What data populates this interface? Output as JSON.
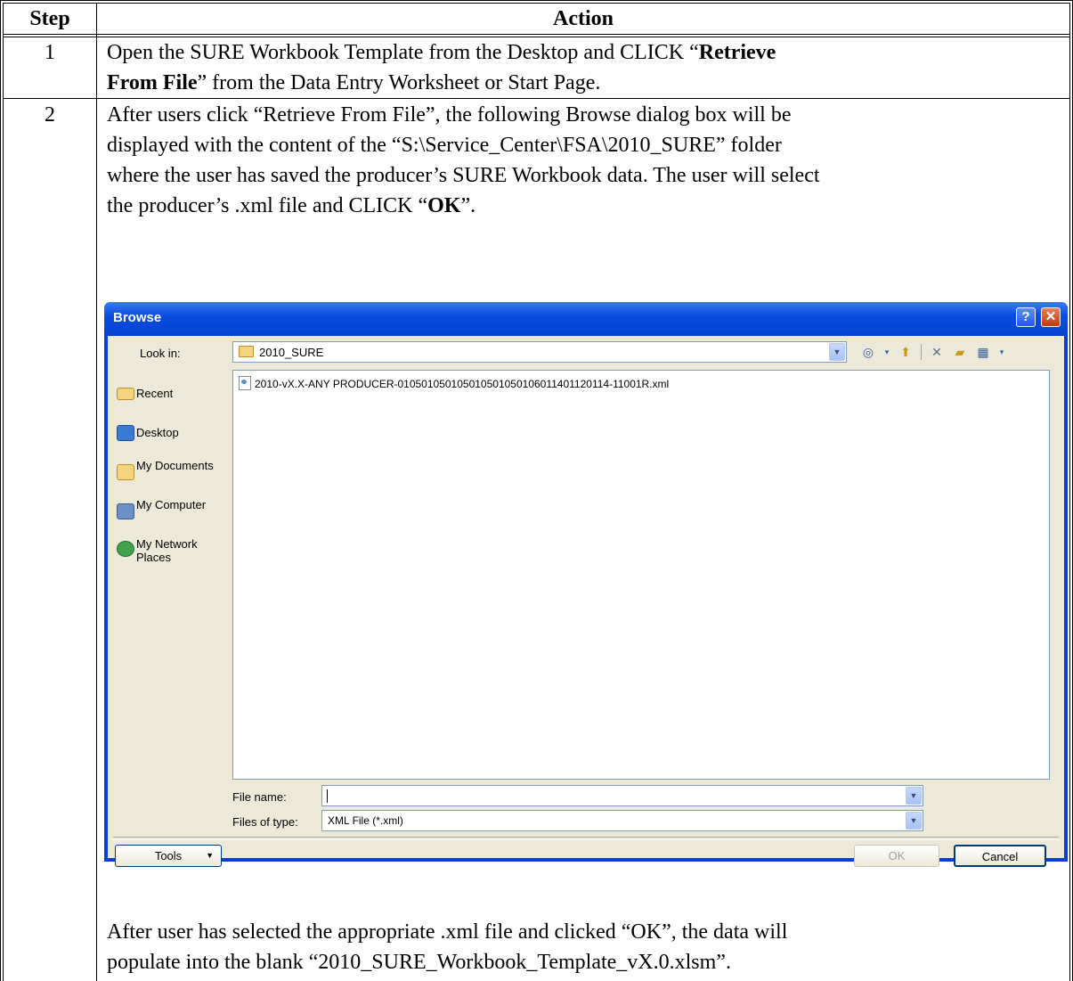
{
  "table": {
    "header_step": "Step",
    "header_action": "Action",
    "rows": [
      {
        "step": "1",
        "line1_pre": "Open the SURE Workbook Template from the Desktop and CLICK “",
        "line1_bold": "Retrieve",
        "line2_bold": "From File",
        "line2_post": "” from the Data Entry Worksheet or Start Page."
      },
      {
        "step": "2",
        "line1": "After users click “Retrieve From File”, the following Browse dialog box will be",
        "line2": "displayed with the content of the “S:\\Service_Center\\FSA\\2010_SURE” folder",
        "line3": "where the user has saved the producer’s SURE Workbook data.  The user will select",
        "line4_pre": "the producer’s .xml file and CLICK “",
        "line4_bold": "OK",
        "line4_post": "”.",
        "after1": "After user has selected the appropriate .xml file and clicked “OK”, the data will",
        "after2": "populate into the blank “2010_SURE_Workbook_Template_vX.0.xlsm”."
      }
    ]
  },
  "dialog": {
    "title": "Browse",
    "help_glyph": "?",
    "close_glyph": "✕",
    "look_in_label": "Look in:",
    "look_in_value": "2010_SURE",
    "places": [
      {
        "label": "Recent",
        "icon": "recent-folder-icon"
      },
      {
        "label": "Desktop",
        "icon": "desktop-icon"
      },
      {
        "label": "My Documents",
        "icon": "my-documents-icon"
      },
      {
        "label": "My Computer",
        "icon": "my-computer-icon"
      },
      {
        "label": "My Network Places",
        "icon": "network-places-icon"
      }
    ],
    "files": [
      "2010-vX.X-ANY PRODUCER-010501050105010501050106011401120114-11001R.xml"
    ],
    "file_name_label": "File name:",
    "file_name_value": "",
    "files_of_type_label": "Files of type:",
    "files_of_type_value": "XML File (*.xml)",
    "tools_label": "Tools",
    "ok_label": "OK",
    "cancel_label": "Cancel",
    "colors": {
      "title_bar": "#0a4ce0",
      "client": "#ece9d8",
      "close_button": "#c13a12"
    }
  }
}
